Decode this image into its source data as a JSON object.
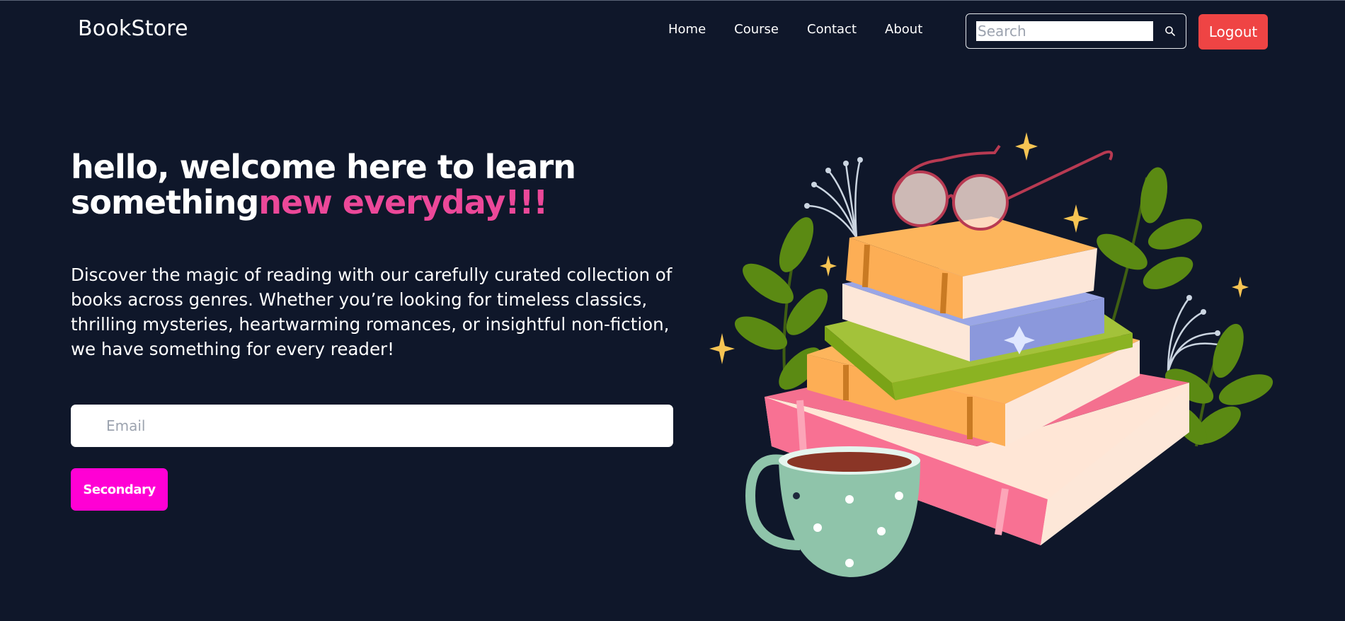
{
  "brand": "BookStore",
  "nav": {
    "links": [
      "Home",
      "Course",
      "Contact",
      "About"
    ]
  },
  "search": {
    "placeholder": "Search",
    "value": ""
  },
  "logout_label": "Logout",
  "hero": {
    "title_part1": "hello, welcome here to learn something",
    "title_accent": "new everyday!!!",
    "description": "Discover the magic of reading with our carefully curated collection of books across genres. Whether you’re looking for timeless classics, thrilling mysteries, heartwarming romances, or insightful non-fiction, we have something for every reader!",
    "email_placeholder": "Email",
    "email_value": "",
    "secondary_label": "Secondary"
  },
  "colors": {
    "background": "#0f172a",
    "accent_pink": "#ec4899",
    "logout_red": "#ef4444",
    "secondary_magenta": "#ff00d4"
  },
  "icons": [
    "search-icon"
  ]
}
